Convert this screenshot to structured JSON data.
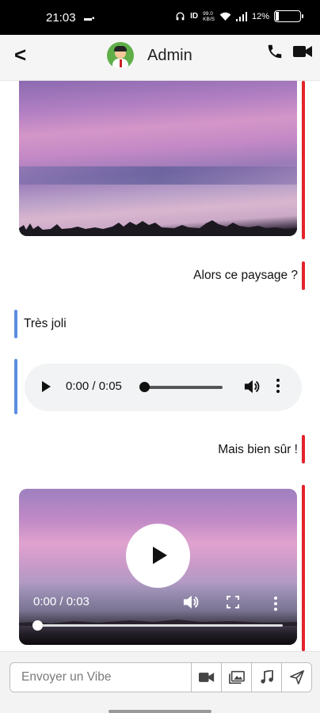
{
  "status_bar": {
    "time": "21:03",
    "battery": "12%",
    "battery_level": 0.12,
    "net_speed_top": "99.0",
    "net_speed_bottom": "KB/S"
  },
  "header": {
    "title": "Admin"
  },
  "messages": {
    "text_sent_1": "Alors ce paysage ?",
    "text_recv_1": "Très joli",
    "audio_time": "0:00 / 0:05",
    "text_sent_2": "Mais bien sûr !",
    "video_time": "0:00 / 0:03"
  },
  "composer": {
    "placeholder": "Envoyer un Vibe"
  },
  "colors": {
    "sent_accent": "#e3232a",
    "received_accent": "#5b8ee0"
  }
}
